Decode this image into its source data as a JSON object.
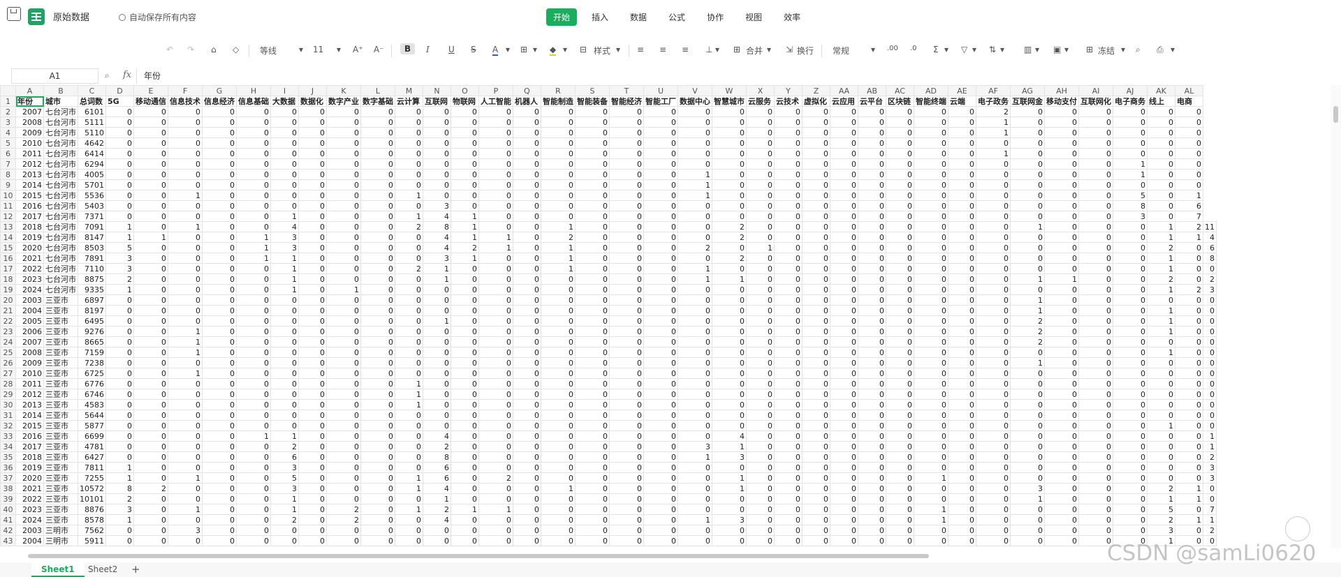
{
  "app": {
    "doc_title": "原始数据",
    "autosave": "自动保存所有内容"
  },
  "menu": [
    "开始",
    "插入",
    "数据",
    "公式",
    "协作",
    "视图",
    "效率"
  ],
  "toolbar": {
    "font": "等线",
    "size": "11",
    "style": "样式",
    "merge": "合并",
    "wrap": "换行",
    "format": "常规",
    "freeze": "冻结"
  },
  "formula": {
    "cell": "A1",
    "content": "年份"
  },
  "columns": [
    "A",
    "B",
    "C",
    "D",
    "E",
    "F",
    "G",
    "H",
    "I",
    "J",
    "K",
    "L",
    "M",
    "N",
    "O",
    "P",
    "Q",
    "R",
    "S",
    "T",
    "U",
    "V",
    "W",
    "X",
    "Y",
    "Z",
    "AA",
    "AB",
    "AC",
    "AD",
    "AE",
    "AF",
    "AG",
    "AH",
    "AI",
    "AJ",
    "AK",
    "AL"
  ],
  "header": [
    "年份",
    "城市",
    "总词数",
    "5G",
    "移动通信",
    "信息技术",
    "信息经济",
    "信息基础",
    "大数据",
    "数据化",
    "数字产业",
    "数字基础",
    "云计算",
    "互联网",
    "物联网",
    "人工智能",
    "机器人",
    "智能制造",
    "智能装备",
    "智能经济",
    "智能工厂",
    "数据中心",
    "智慧城市",
    "云服务",
    "云技术",
    "虚拟化",
    "云应用",
    "云平台",
    "区块链",
    "智能终端",
    "云端",
    "电子政务",
    "互联网金",
    "移动支付",
    "互联网化",
    "电子商务",
    "线上",
    "电商"
  ],
  "rows": [
    [
      "2007",
      "七台河市",
      "6101",
      0,
      0,
      0,
      0,
      0,
      0,
      0,
      0,
      0,
      0,
      0,
      0,
      0,
      0,
      0,
      0,
      0,
      0,
      0,
      0,
      0,
      0,
      0,
      0,
      0,
      0,
      0,
      0,
      2,
      0,
      0,
      0,
      0,
      0,
      0
    ],
    [
      "2008",
      "七台河市",
      "5111",
      0,
      0,
      0,
      0,
      0,
      0,
      0,
      0,
      0,
      0,
      0,
      0,
      0,
      0,
      0,
      0,
      0,
      0,
      0,
      0,
      0,
      0,
      0,
      0,
      0,
      0,
      0,
      0,
      1,
      0,
      0,
      0,
      0,
      0,
      0
    ],
    [
      "2009",
      "七台河市",
      "5110",
      0,
      0,
      0,
      0,
      0,
      0,
      0,
      0,
      0,
      0,
      0,
      0,
      0,
      0,
      0,
      0,
      0,
      0,
      0,
      0,
      0,
      0,
      0,
      0,
      0,
      0,
      0,
      0,
      1,
      0,
      0,
      0,
      0,
      0,
      0
    ],
    [
      "2010",
      "七台河市",
      "4642",
      0,
      0,
      0,
      0,
      0,
      0,
      0,
      0,
      0,
      0,
      0,
      0,
      0,
      0,
      0,
      0,
      0,
      0,
      0,
      0,
      0,
      0,
      0,
      0,
      0,
      0,
      0,
      0,
      0,
      0,
      0,
      0,
      0,
      0,
      0
    ],
    [
      "2011",
      "七台河市",
      "6414",
      0,
      0,
      0,
      0,
      0,
      0,
      0,
      0,
      0,
      0,
      0,
      0,
      0,
      0,
      0,
      0,
      0,
      0,
      0,
      0,
      0,
      0,
      0,
      0,
      0,
      0,
      0,
      0,
      1,
      0,
      0,
      0,
      0,
      0,
      0
    ],
    [
      "2012",
      "七台河市",
      "6294",
      0,
      0,
      0,
      0,
      0,
      0,
      0,
      0,
      0,
      0,
      0,
      0,
      0,
      0,
      0,
      0,
      0,
      0,
      0,
      0,
      0,
      0,
      0,
      0,
      0,
      0,
      0,
      0,
      0,
      0,
      0,
      0,
      1,
      0,
      0
    ],
    [
      "2013",
      "七台河市",
      "4005",
      0,
      0,
      0,
      0,
      0,
      0,
      0,
      0,
      0,
      0,
      0,
      0,
      0,
      0,
      0,
      0,
      0,
      0,
      1,
      0,
      0,
      0,
      0,
      0,
      0,
      0,
      0,
      0,
      0,
      0,
      0,
      0,
      1,
      0,
      0
    ],
    [
      "2014",
      "七台河市",
      "5701",
      0,
      0,
      0,
      0,
      0,
      0,
      0,
      0,
      0,
      0,
      0,
      0,
      0,
      0,
      0,
      0,
      0,
      0,
      1,
      0,
      0,
      0,
      0,
      0,
      0,
      0,
      0,
      0,
      0,
      0,
      0,
      0,
      0,
      0,
      0
    ],
    [
      "2015",
      "七台河市",
      "5536",
      0,
      0,
      1,
      0,
      0,
      0,
      0,
      0,
      0,
      1,
      0,
      0,
      0,
      0,
      0,
      0,
      0,
      0,
      1,
      0,
      0,
      0,
      0,
      0,
      0,
      0,
      0,
      0,
      0,
      0,
      0,
      0,
      5,
      0,
      1
    ],
    [
      "2016",
      "七台河市",
      "5403",
      0,
      0,
      0,
      0,
      0,
      0,
      0,
      0,
      0,
      0,
      3,
      0,
      0,
      0,
      0,
      0,
      0,
      0,
      0,
      0,
      0,
      0,
      0,
      0,
      0,
      0,
      0,
      0,
      0,
      0,
      0,
      0,
      8,
      0,
      6
    ],
    [
      "2017",
      "七台河市",
      "7371",
      0,
      0,
      0,
      0,
      0,
      1,
      0,
      0,
      0,
      1,
      4,
      1,
      0,
      0,
      0,
      0,
      0,
      0,
      0,
      0,
      0,
      0,
      0,
      0,
      0,
      0,
      0,
      0,
      0,
      0,
      0,
      0,
      3,
      0,
      7
    ],
    [
      "2018",
      "七台河市",
      "7091",
      1,
      0,
      1,
      0,
      0,
      4,
      0,
      0,
      0,
      2,
      8,
      1,
      0,
      0,
      1,
      0,
      0,
      0,
      0,
      2,
      0,
      0,
      0,
      0,
      0,
      0,
      0,
      0,
      0,
      1,
      0,
      0,
      0,
      1,
      2,
      11
    ],
    [
      "2019",
      "七台河市",
      "8147",
      1,
      1,
      0,
      0,
      1,
      3,
      0,
      0,
      0,
      0,
      4,
      1,
      1,
      0,
      2,
      0,
      0,
      0,
      0,
      2,
      0,
      0,
      0,
      0,
      0,
      0,
      0,
      0,
      0,
      0,
      0,
      0,
      0,
      1,
      1,
      4
    ],
    [
      "2020",
      "七台河市",
      "8503",
      5,
      0,
      0,
      0,
      1,
      3,
      0,
      0,
      0,
      0,
      4,
      2,
      1,
      0,
      1,
      0,
      0,
      0,
      2,
      0,
      1,
      0,
      0,
      0,
      0,
      0,
      0,
      0,
      0,
      0,
      0,
      0,
      0,
      2,
      0,
      6
    ],
    [
      "2021",
      "七台河市",
      "7891",
      3,
      0,
      0,
      0,
      1,
      1,
      0,
      0,
      0,
      0,
      3,
      1,
      0,
      0,
      1,
      0,
      0,
      0,
      0,
      2,
      0,
      0,
      0,
      0,
      0,
      0,
      0,
      0,
      0,
      0,
      0,
      0,
      0,
      1,
      0,
      8
    ],
    [
      "2022",
      "七台河市",
      "7110",
      3,
      0,
      0,
      0,
      0,
      1,
      0,
      0,
      0,
      2,
      1,
      0,
      0,
      0,
      1,
      0,
      0,
      0,
      1,
      0,
      0,
      0,
      0,
      0,
      0,
      0,
      0,
      0,
      0,
      0,
      0,
      0,
      0,
      1,
      0,
      0
    ],
    [
      "2023",
      "七台河市",
      "8875",
      2,
      0,
      0,
      0,
      0,
      1,
      0,
      0,
      0,
      0,
      1,
      0,
      0,
      0,
      0,
      0,
      0,
      0,
      1,
      1,
      0,
      0,
      0,
      0,
      0,
      0,
      0,
      0,
      0,
      1,
      1,
      0,
      0,
      2,
      0,
      2
    ],
    [
      "2024",
      "七台河市",
      "9335",
      1,
      0,
      0,
      0,
      0,
      1,
      0,
      1,
      0,
      0,
      0,
      0,
      0,
      0,
      0,
      0,
      0,
      0,
      0,
      0,
      0,
      0,
      0,
      0,
      0,
      0,
      0,
      0,
      0,
      0,
      0,
      0,
      0,
      1,
      2,
      3
    ],
    [
      "2003",
      "三亚市",
      "6897",
      0,
      0,
      0,
      0,
      0,
      0,
      0,
      0,
      0,
      0,
      0,
      0,
      0,
      0,
      0,
      0,
      0,
      0,
      0,
      0,
      0,
      0,
      0,
      0,
      0,
      0,
      0,
      0,
      0,
      1,
      0,
      0,
      0,
      0,
      0,
      0
    ],
    [
      "2004",
      "三亚市",
      "8197",
      0,
      0,
      0,
      0,
      0,
      0,
      0,
      0,
      0,
      0,
      0,
      0,
      0,
      0,
      0,
      0,
      0,
      0,
      0,
      0,
      0,
      0,
      0,
      0,
      0,
      0,
      0,
      0,
      0,
      1,
      0,
      0,
      0,
      1,
      0,
      0
    ],
    [
      "2005",
      "三亚市",
      "6495",
      0,
      0,
      0,
      0,
      0,
      0,
      0,
      0,
      0,
      0,
      1,
      0,
      0,
      0,
      0,
      0,
      0,
      0,
      0,
      0,
      0,
      0,
      0,
      0,
      0,
      0,
      0,
      0,
      0,
      2,
      0,
      0,
      0,
      1,
      0,
      0
    ],
    [
      "2006",
      "三亚市",
      "9276",
      0,
      0,
      1,
      0,
      0,
      0,
      0,
      0,
      0,
      0,
      0,
      0,
      0,
      0,
      0,
      0,
      0,
      0,
      0,
      0,
      0,
      0,
      0,
      0,
      0,
      0,
      0,
      0,
      0,
      2,
      0,
      0,
      0,
      1,
      0,
      0
    ],
    [
      "2007",
      "三亚市",
      "8665",
      0,
      0,
      1,
      0,
      0,
      0,
      0,
      0,
      0,
      0,
      0,
      0,
      0,
      0,
      0,
      0,
      0,
      0,
      0,
      0,
      0,
      0,
      0,
      0,
      0,
      0,
      0,
      0,
      0,
      2,
      0,
      0,
      0,
      0,
      0,
      0
    ],
    [
      "2008",
      "三亚市",
      "7159",
      0,
      0,
      1,
      0,
      0,
      0,
      0,
      0,
      0,
      0,
      0,
      0,
      0,
      0,
      0,
      0,
      0,
      0,
      0,
      0,
      0,
      0,
      0,
      0,
      0,
      0,
      0,
      0,
      0,
      0,
      0,
      0,
      0,
      1,
      0,
      0
    ],
    [
      "2009",
      "三亚市",
      "7238",
      0,
      0,
      0,
      0,
      0,
      0,
      0,
      0,
      0,
      0,
      0,
      0,
      0,
      0,
      0,
      0,
      0,
      0,
      0,
      0,
      0,
      0,
      0,
      0,
      0,
      0,
      0,
      0,
      0,
      1,
      0,
      0,
      0,
      0,
      0,
      0
    ],
    [
      "2010",
      "三亚市",
      "6725",
      0,
      0,
      1,
      0,
      0,
      0,
      0,
      0,
      0,
      0,
      0,
      0,
      0,
      0,
      0,
      0,
      0,
      0,
      0,
      0,
      0,
      0,
      0,
      0,
      0,
      0,
      0,
      0,
      0,
      0,
      0,
      0,
      0,
      0,
      0,
      0
    ],
    [
      "2011",
      "三亚市",
      "6776",
      0,
      0,
      0,
      0,
      0,
      0,
      0,
      0,
      0,
      1,
      0,
      0,
      0,
      0,
      0,
      0,
      0,
      0,
      0,
      0,
      0,
      0,
      0,
      0,
      0,
      0,
      0,
      0,
      0,
      0,
      0,
      0,
      0,
      0,
      0,
      0
    ],
    [
      "2012",
      "三亚市",
      "6746",
      0,
      0,
      0,
      0,
      0,
      0,
      0,
      0,
      0,
      1,
      0,
      0,
      0,
      0,
      0,
      0,
      0,
      0,
      0,
      0,
      0,
      0,
      0,
      0,
      0,
      0,
      0,
      0,
      0,
      0,
      0,
      0,
      0,
      0,
      0,
      0
    ],
    [
      "2013",
      "三亚市",
      "4583",
      0,
      0,
      0,
      0,
      0,
      0,
      0,
      0,
      0,
      1,
      0,
      0,
      0,
      0,
      0,
      0,
      0,
      0,
      0,
      0,
      0,
      0,
      0,
      0,
      0,
      0,
      0,
      0,
      0,
      0,
      0,
      0,
      0,
      0,
      0,
      0
    ],
    [
      "2014",
      "三亚市",
      "5644",
      0,
      0,
      0,
      0,
      0,
      0,
      0,
      0,
      0,
      0,
      0,
      0,
      0,
      0,
      0,
      0,
      0,
      0,
      0,
      0,
      0,
      0,
      0,
      0,
      0,
      0,
      0,
      0,
      0,
      0,
      0,
      0,
      0,
      0,
      0,
      0
    ],
    [
      "2015",
      "三亚市",
      "5877",
      0,
      0,
      0,
      0,
      0,
      0,
      0,
      0,
      0,
      0,
      0,
      0,
      0,
      0,
      0,
      0,
      0,
      0,
      0,
      0,
      0,
      0,
      0,
      0,
      0,
      0,
      0,
      0,
      0,
      0,
      0,
      0,
      0,
      1,
      0,
      0
    ],
    [
      "2016",
      "三亚市",
      "6699",
      0,
      0,
      0,
      0,
      1,
      1,
      0,
      0,
      0,
      0,
      4,
      0,
      0,
      0,
      0,
      0,
      0,
      0,
      0,
      4,
      0,
      0,
      0,
      0,
      0,
      0,
      0,
      0,
      0,
      0,
      0,
      0,
      0,
      0,
      0,
      1
    ],
    [
      "2017",
      "三亚市",
      "4781",
      0,
      0,
      0,
      0,
      0,
      2,
      0,
      0,
      0,
      0,
      2,
      0,
      0,
      0,
      0,
      0,
      0,
      0,
      3,
      1,
      0,
      0,
      0,
      0,
      0,
      0,
      0,
      0,
      0,
      0,
      0,
      0,
      0,
      0,
      0,
      1
    ],
    [
      "2018",
      "三亚市",
      "6427",
      0,
      0,
      0,
      0,
      0,
      6,
      0,
      0,
      0,
      0,
      8,
      0,
      0,
      0,
      0,
      0,
      0,
      0,
      1,
      3,
      0,
      0,
      0,
      0,
      0,
      0,
      0,
      0,
      0,
      0,
      0,
      0,
      0,
      0,
      0,
      2
    ],
    [
      "2019",
      "三亚市",
      "7811",
      1,
      0,
      0,
      0,
      0,
      3,
      0,
      0,
      0,
      0,
      6,
      0,
      0,
      0,
      0,
      0,
      0,
      0,
      0,
      0,
      0,
      0,
      0,
      0,
      0,
      0,
      0,
      0,
      0,
      0,
      0,
      0,
      0,
      0,
      0,
      3
    ],
    [
      "2020",
      "三亚市",
      "7255",
      1,
      0,
      1,
      0,
      0,
      5,
      0,
      0,
      0,
      1,
      6,
      0,
      2,
      0,
      0,
      0,
      0,
      0,
      0,
      1,
      0,
      0,
      0,
      0,
      0,
      0,
      1,
      0,
      0,
      0,
      0,
      0,
      0,
      0,
      0,
      3
    ],
    [
      "2021",
      "三亚市",
      "10572",
      8,
      2,
      0,
      0,
      0,
      3,
      0,
      0,
      0,
      1,
      4,
      0,
      0,
      0,
      1,
      0,
      0,
      0,
      0,
      1,
      0,
      0,
      0,
      0,
      0,
      0,
      0,
      0,
      0,
      3,
      0,
      0,
      0,
      2,
      1,
      0
    ],
    [
      "2022",
      "三亚市",
      "10101",
      2,
      0,
      0,
      0,
      0,
      1,
      0,
      0,
      0,
      0,
      1,
      0,
      0,
      0,
      0,
      0,
      0,
      0,
      0,
      0,
      0,
      0,
      0,
      0,
      0,
      0,
      0,
      0,
      0,
      1,
      0,
      0,
      0,
      1,
      1,
      0
    ],
    [
      "2023",
      "三亚市",
      "8876",
      3,
      0,
      1,
      0,
      0,
      1,
      0,
      2,
      0,
      1,
      2,
      1,
      1,
      0,
      0,
      0,
      0,
      0,
      0,
      0,
      0,
      0,
      0,
      0,
      0,
      0,
      1,
      0,
      0,
      0,
      0,
      0,
      0,
      5,
      0,
      7
    ],
    [
      "2024",
      "三亚市",
      "8578",
      1,
      0,
      0,
      0,
      0,
      2,
      0,
      2,
      0,
      0,
      4,
      0,
      0,
      0,
      0,
      0,
      0,
      0,
      1,
      3,
      0,
      0,
      0,
      0,
      0,
      0,
      1,
      0,
      0,
      0,
      0,
      0,
      0,
      2,
      1,
      1
    ],
    [
      "2003",
      "三明市",
      "7562",
      0,
      0,
      3,
      0,
      0,
      0,
      0,
      0,
      0,
      0,
      0,
      0,
      0,
      0,
      0,
      0,
      0,
      0,
      0,
      0,
      0,
      0,
      0,
      0,
      0,
      0,
      0,
      0,
      0,
      0,
      0,
      0,
      0,
      3,
      0,
      2
    ],
    [
      "2004",
      "三明市",
      "5911",
      0,
      0,
      0,
      0,
      0,
      0,
      0,
      0,
      0,
      0,
      0,
      0,
      0,
      0,
      0,
      0,
      0,
      0,
      0,
      0,
      0,
      0,
      0,
      0,
      0,
      0,
      0,
      0,
      0,
      0,
      0,
      0,
      0,
      1,
      0,
      0
    ]
  ],
  "sheets": [
    "Sheet1",
    "Sheet2"
  ],
  "watermark": "CSDN @samLi0620"
}
